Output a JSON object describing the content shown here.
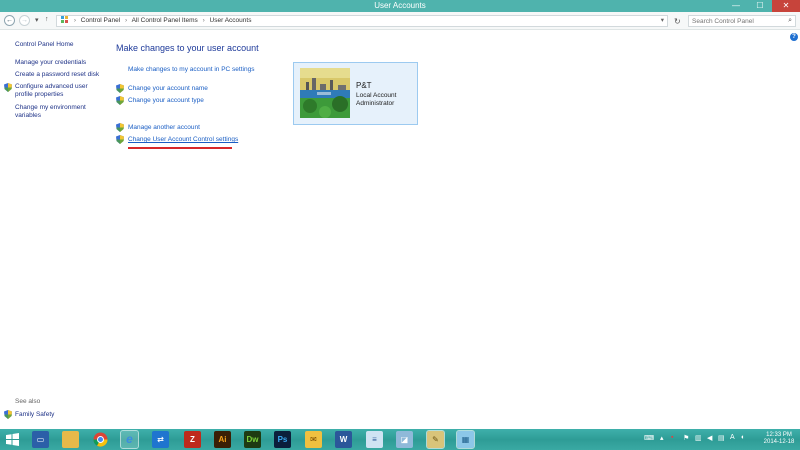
{
  "window": {
    "title": "User Accounts",
    "controls": {
      "minimize": "—",
      "maximize": "☐",
      "close": "✕"
    }
  },
  "address": {
    "breadcrumb": [
      "Control Panel",
      "All Control Panel Items",
      "User Accounts"
    ],
    "search_placeholder": "Search Control Panel"
  },
  "sidebar": {
    "home": "Control Panel Home",
    "items": [
      {
        "label": "Manage your credentials",
        "shield": false
      },
      {
        "label": "Create a password reset disk",
        "shield": false
      },
      {
        "label": "Configure advanced user profile properties",
        "line1": "Configure advanced user",
        "line2": "profile properties",
        "shield": true
      },
      {
        "label": "Change my environment variables",
        "line1": "Change my environment",
        "line2": "variables",
        "shield": false
      }
    ],
    "see_also": "See also",
    "family_safety": "Family Safety"
  },
  "main": {
    "heading": "Make changes to your user account",
    "tasks": [
      {
        "label": "Make changes to my account in PC settings",
        "shield": false
      },
      {
        "label": "Change your account name",
        "shield": true
      },
      {
        "label": "Change your account type",
        "shield": true
      },
      {
        "label": "Manage another account",
        "shield": true
      },
      {
        "label": "Change User Account Control settings",
        "shield": true
      }
    ]
  },
  "account": {
    "name": "P&T",
    "type": "Local Account",
    "role": "Administrator"
  },
  "help": {
    "label": "?"
  },
  "taskbar": {
    "apps": [
      {
        "name": "start-icon",
        "label": ""
      },
      {
        "name": "this-pc-icon",
        "label": ""
      },
      {
        "name": "file-explorer-icon",
        "label": ""
      },
      {
        "name": "chrome-icon",
        "label": ""
      },
      {
        "name": "internet-explorer-icon",
        "label": "e"
      },
      {
        "name": "teamviewer-icon",
        "label": ""
      },
      {
        "name": "filezilla-icon",
        "label": "Z"
      },
      {
        "name": "illustrator-icon",
        "label": "Ai"
      },
      {
        "name": "dreamweaver-icon",
        "label": "Dw"
      },
      {
        "name": "photoshop-icon",
        "label": "Ps"
      },
      {
        "name": "mail-icon",
        "label": ""
      },
      {
        "name": "word-icon",
        "label": "W"
      },
      {
        "name": "notepad-icon",
        "label": ""
      },
      {
        "name": "app-icon",
        "label": ""
      },
      {
        "name": "tools-icon",
        "label": ""
      },
      {
        "name": "control-panel-icon",
        "label": ""
      }
    ],
    "time": "12:33 PM",
    "date": "2014-12-18"
  },
  "colors": {
    "titlebar": "#4fb3ad",
    "link": "#1a5ec4",
    "heading": "#1e3a9a",
    "card_bg": "#e6f1fb",
    "card_border": "#9ccaf0",
    "highlight_line": "#d8282a"
  }
}
